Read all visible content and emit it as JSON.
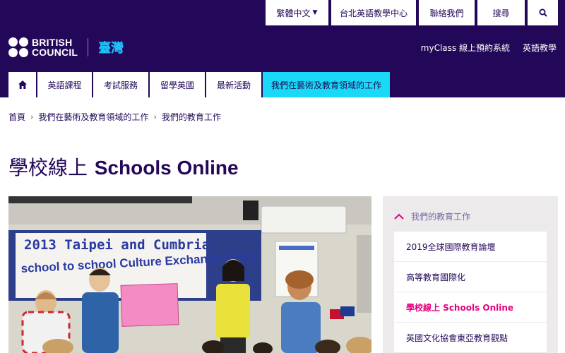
{
  "utility_nav": {
    "language": "繁體中文",
    "center": "台北英語教學中心",
    "contact": "聯絡我們",
    "search": "搜尋"
  },
  "brand": {
    "line1": "BRITISH",
    "line2": "COUNCIL",
    "country": "臺灣"
  },
  "top_links": [
    "myClass 線上預約系統",
    "英語教學"
  ],
  "main_nav": {
    "items": [
      "英語課程",
      "考試服務",
      "留學英國",
      "最新活動",
      "我們在藝術及教育領域的工作"
    ],
    "active_index": 4
  },
  "breadcrumb": [
    "首頁",
    "我們在藝術及教育領域的工作",
    "我們的教育工作"
  ],
  "page_title": {
    "zh": "學校線上",
    "en": "Schools Online"
  },
  "photo": {
    "banner_line1": "2013 Taipei and Cumbria",
    "banner_line2": "school to school Culture Exchange Event"
  },
  "side_menu": {
    "heading": "我們的教育工作",
    "items": [
      "2019全球國際教育論壇",
      "高等教育國際化",
      "學校線上 Schools Online",
      "英國文化協會東亞教育觀點"
    ],
    "current_index": 2
  },
  "colors": {
    "brand_purple": "#23085a",
    "accent_cyan": "#19d9f7",
    "current_pink": "#e6007e"
  },
  "icons": [
    "home-icon",
    "search-icon",
    "chevron-up-icon",
    "caret-down-icon"
  ]
}
